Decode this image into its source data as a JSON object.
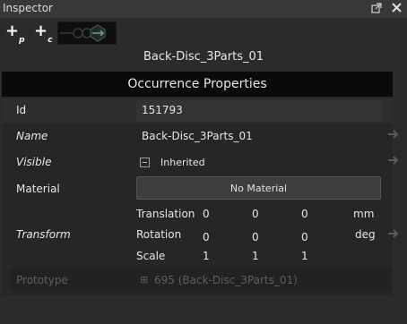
{
  "window": {
    "title": "Inspector",
    "popout_icon": "popout-icon",
    "close_icon": "close-icon"
  },
  "toolbar": {
    "add_p": "+",
    "add_p_sub": "p",
    "add_c": "+",
    "add_c_sub": "c"
  },
  "selected_name": "Back-Disc_3Parts_01",
  "section_title": "Occurrence Properties",
  "properties": {
    "id": {
      "label": "Id",
      "value": "151793"
    },
    "name": {
      "label": "Name",
      "value": "Back-Disc_3Parts_01"
    },
    "visible": {
      "label": "Visible",
      "value": "Inherited"
    },
    "material": {
      "label": "Material",
      "value": "No Material"
    },
    "transform": {
      "label": "Transform",
      "translation": {
        "label": "Translation",
        "x": "0",
        "y": "0",
        "z": "0",
        "unit": "mm"
      },
      "rotation": {
        "label": "Rotation",
        "x": "0",
        "y": "0",
        "z": "0",
        "unit": "deg"
      },
      "scale": {
        "label": "Scale",
        "x": "1",
        "y": "1",
        "z": "1"
      }
    },
    "prototype": {
      "label": "Prototype",
      "value": "695 (Back-Disc_3Parts_01)"
    }
  },
  "colors": {
    "background": "#2b2b2b",
    "section": "#0a0a0a",
    "title_bar": "#383838"
  }
}
